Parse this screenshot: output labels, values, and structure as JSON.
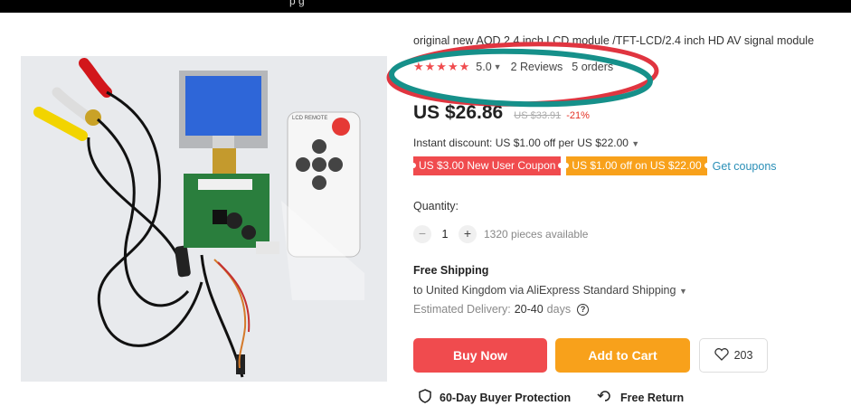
{
  "top_bar": {
    "text": "p g"
  },
  "product": {
    "title": "original new AOD 2.4 inch LCD module /TFT-LCD/2.4 inch HD AV signal module",
    "remote_label": "LCD REMOTE",
    "rating": {
      "stars": "★★★★★",
      "value": "5.0",
      "reviews": "2 Reviews",
      "orders": "5 orders"
    },
    "price": {
      "current": "US $26.86",
      "original": "US $33.91",
      "discount": "-21%"
    },
    "instant_discount": "Instant discount: US $1.00 off per US $22.00",
    "coupons": [
      "US $3.00 New User Coupon",
      "US $1.00 off on US $22.00"
    ],
    "get_coupons": "Get coupons",
    "quantity": {
      "label": "Quantity:",
      "minus": "−",
      "value": "1",
      "plus": "+",
      "available": "1320 pieces available"
    },
    "shipping": {
      "title": "Free Shipping",
      "destination": "to United Kingdom via AliExpress Standard Shipping",
      "estimated_label": "Estimated Delivery:",
      "estimated_value": "20-40",
      "estimated_unit": "days",
      "help": "?"
    },
    "actions": {
      "buy_now": "Buy Now",
      "add_to_cart": "Add to Cart",
      "wishlist_count": "203"
    },
    "protection": {
      "buyer": "60-Day Buyer Protection",
      "return": "Free Return"
    }
  },
  "colors": {
    "accent_red": "#f04b4e",
    "accent_orange": "#f8a11b",
    "link_blue": "#2a8fb7",
    "annotation_red": "#e03540",
    "annotation_teal": "#16908a"
  },
  "icons": [
    "chevron-down-icon",
    "help-icon",
    "heart-icon",
    "shield-icon",
    "return-icon"
  ]
}
